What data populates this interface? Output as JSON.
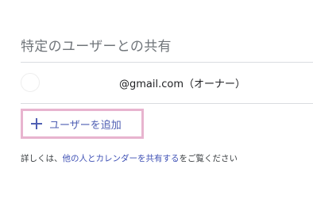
{
  "section": {
    "title": "特定のユーザーとの共有"
  },
  "share_list": [
    {
      "email": "@gmail.com（オーナー）"
    }
  ],
  "add_user": {
    "label": "ユーザーを追加",
    "icon": "plus-icon"
  },
  "help": {
    "prefix": "詳しくは、",
    "link_text": "他の人とカレンダーを共有する",
    "suffix": "をご覧ください"
  },
  "colors": {
    "accent": "#4f5fb3",
    "focus_outline": "#e8b4cf",
    "divider": "#dadce0"
  }
}
